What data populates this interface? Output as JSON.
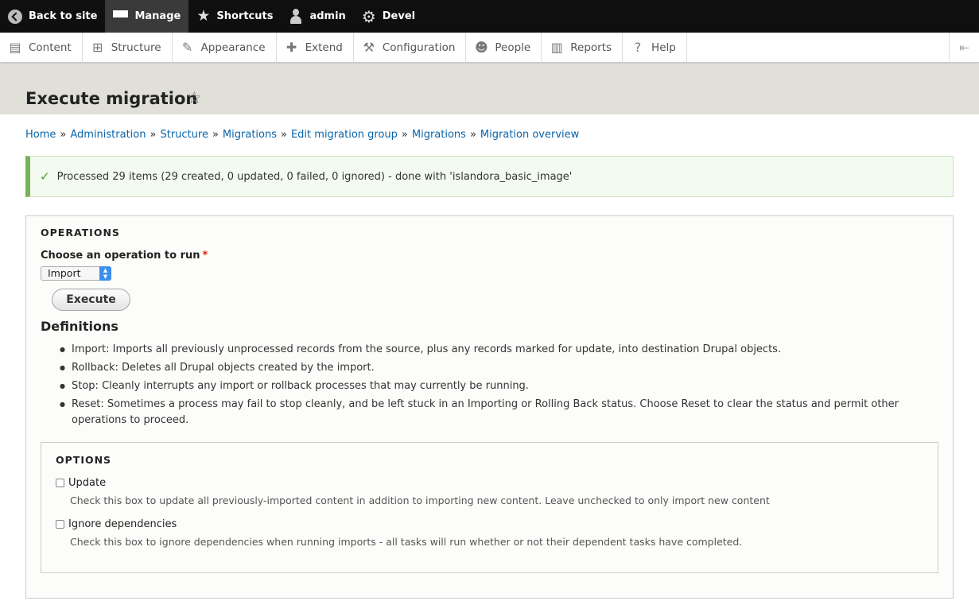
{
  "toolbar": {
    "back_label": "Back to site",
    "manage_label": "Manage",
    "shortcuts_label": "Shortcuts",
    "user_label": "admin",
    "devel_label": "Devel"
  },
  "tray": {
    "items": [
      {
        "label": "Content",
        "icon": "document-icon"
      },
      {
        "label": "Structure",
        "icon": "structure-icon"
      },
      {
        "label": "Appearance",
        "icon": "paintbrush-icon"
      },
      {
        "label": "Extend",
        "icon": "puzzle-icon"
      },
      {
        "label": "Configuration",
        "icon": "wrench-icon"
      },
      {
        "label": "People",
        "icon": "people-icon"
      },
      {
        "label": "Reports",
        "icon": "bar-chart-icon"
      },
      {
        "label": "Help",
        "icon": "help-icon"
      }
    ]
  },
  "page": {
    "title": "Execute migration"
  },
  "breadcrumb": [
    "Home",
    "Administration",
    "Structure",
    "Migrations",
    "Edit migration group",
    "Migrations",
    "Migration overview"
  ],
  "status": {
    "message": "Processed 29 items (29 created, 0 updated, 0 failed, 0 ignored) - done with 'islandora_basic_image'"
  },
  "operations": {
    "legend": "OPERATIONS",
    "choose_label": "Choose an operation to run",
    "selected": "Import",
    "execute_label": "Execute",
    "definitions_title": "Definitions",
    "definitions": [
      "Import: Imports all previously unprocessed records from the source, plus any records marked for update, into destination Drupal objects.",
      "Rollback: Deletes all Drupal objects created by the import.",
      "Stop: Cleanly interrupts any import or rollback processes that may currently be running.",
      "Reset: Sometimes a process may fail to stop cleanly, and be left stuck in an Importing or Rolling Back status. Choose Reset to clear the status and permit other operations to proceed."
    ]
  },
  "options": {
    "legend": "OPTIONS",
    "update_label": "Update",
    "update_desc": "Check this box to update all previously-imported content in addition to importing new content. Leave unchecked to only import new content",
    "ignore_label": "Ignore dependencies",
    "ignore_desc": "Check this box to ignore dependencies when running imports - all tasks will run whether or not their dependent tasks have completed."
  }
}
